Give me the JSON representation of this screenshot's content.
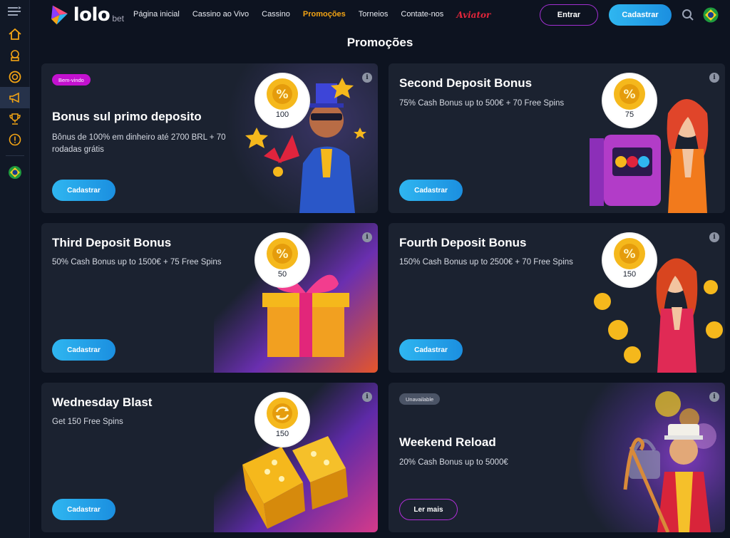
{
  "header": {
    "logo_text": "lolo",
    "logo_sub": "bet",
    "nav": [
      "Página inicial",
      "Cassino ao Vivo",
      "Cassino",
      "Promoções",
      "Torneios",
      "Contate-nos"
    ],
    "aviator": "Aviator",
    "login_label": "Entrar",
    "register_label": "Cadastrar"
  },
  "page_title": "Promoções",
  "cards": [
    {
      "badge": "Bem-vindo",
      "title": "Bonus sul primo deposito",
      "desc": "Bônus de 100% em dinheiro até 2700 BRL + 70 rodadas grátis",
      "coin": "100",
      "button": "Cadastrar"
    },
    {
      "title": "Second Deposit Bonus",
      "desc": "75% Cash Bonus up to 500€ + 70 Free Spins",
      "coin": "75",
      "button": "Cadastrar"
    },
    {
      "title": "Third Deposit Bonus",
      "desc": "50% Cash Bonus up to 1500€ + 75 Free Spins",
      "coin": "50",
      "button": "Cadastrar"
    },
    {
      "title": "Fourth Deposit Bonus",
      "desc": "150% Cash Bonus up to 2500€ + 70 Free Spins",
      "coin": "150",
      "button": "Cadastrar"
    },
    {
      "title": "Wednesday Blast",
      "desc": "Get 150 Free Spins",
      "coin": "150",
      "button": "Cadastrar"
    },
    {
      "badge": "Unavailable",
      "title": "Weekend Reload",
      "desc": "20% Cash Bonus up to 5000€",
      "button": "Ler mais"
    }
  ],
  "sidebar_icons": [
    "menu-icon",
    "home-icon",
    "slot-machine-icon",
    "live-casino-icon",
    "megaphone-icon",
    "trophy-icon",
    "info-icon",
    "brazil-flag-icon"
  ],
  "colors": {
    "accent_orange": "#f3a414",
    "accent_blue": "#2fb6f0",
    "accent_purple": "#a12fd1",
    "aviator_red": "#e2263b"
  }
}
